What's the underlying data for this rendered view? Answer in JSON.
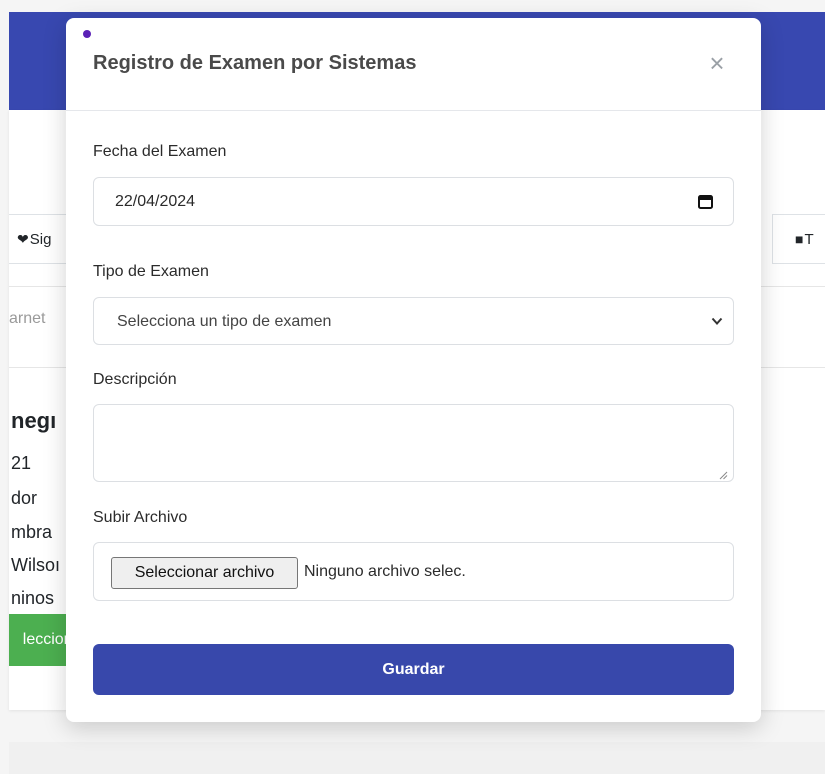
{
  "background": {
    "tab_left_label": "Sig",
    "tab_right_label": "T",
    "search_placeholder": "arnet",
    "patient_name": "negı",
    "info_lines": [
      "21",
      "dor",
      "mbra",
      "Wilsoı",
      "ninos"
    ],
    "select_button_label": "leccior"
  },
  "modal": {
    "title": "Registro de Examen por Sistemas",
    "close_icon": "×",
    "fields": {
      "date_label": "Fecha del Examen",
      "date_value": "22/04/2024",
      "type_label": "Tipo de Examen",
      "type_placeholder": "Selecciona un tipo de examen",
      "description_label": "Descripción",
      "description_value": "",
      "file_label": "Subir Archivo",
      "file_button_label": "Seleccionar archivo",
      "file_status": "Ninguno archivo selec."
    },
    "save_label": "Guardar"
  },
  "colors": {
    "header_blue": "#3848b0",
    "save_button": "#3848ab",
    "select_green": "#4caf50",
    "accent_dot": "#5b21b6"
  }
}
